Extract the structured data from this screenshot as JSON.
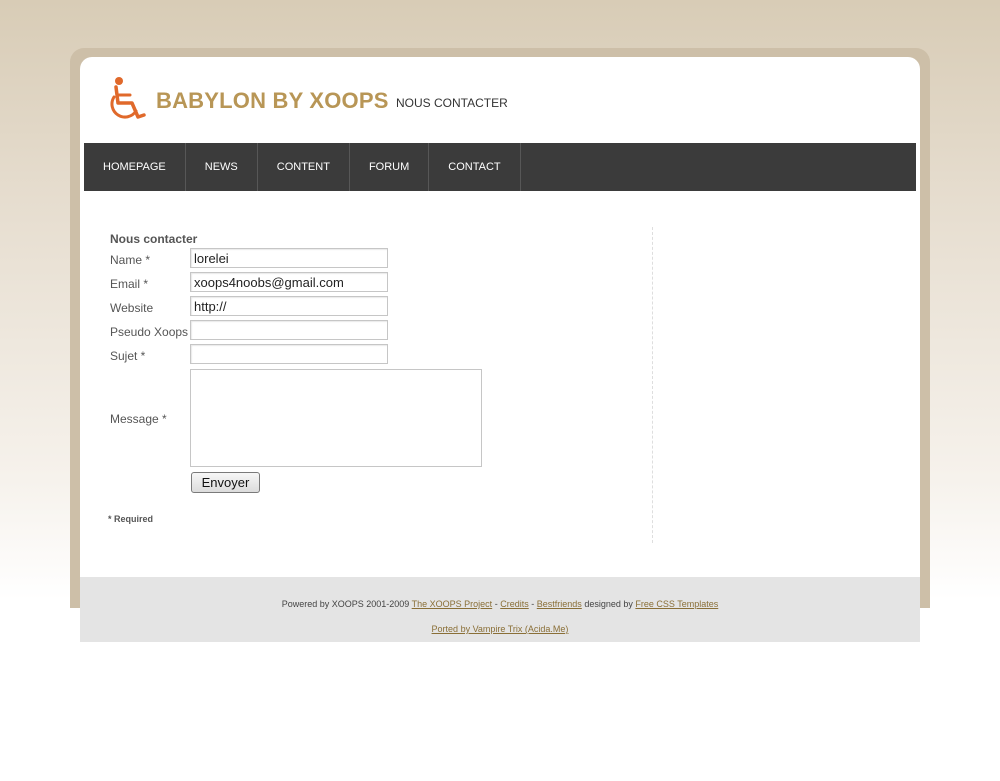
{
  "header": {
    "title": "BABYLON BY XOOPS",
    "subtitle": "NOUS CONTACTER",
    "logo_icon": "wheelchair-icon",
    "accent_color": "#b89656",
    "icon_color": "#e0692b"
  },
  "nav": {
    "items": [
      {
        "label": "HOMEPAGE"
      },
      {
        "label": "NEWS"
      },
      {
        "label": "CONTENT"
      },
      {
        "label": "FORUM"
      },
      {
        "label": "CONTACT"
      }
    ]
  },
  "form": {
    "title": "Nous contacter",
    "name_label": "Name *",
    "name_value": "lorelei",
    "email_label": "Email *",
    "email_value": "xoops4noobs@gmail.com",
    "website_label": "Website",
    "website_value": "http://",
    "pseudo_label": "Pseudo Xoops",
    "pseudo_value": "",
    "subject_label": "Sujet *",
    "subject_value": "",
    "message_label": "Message *",
    "message_value": "",
    "submit_label": "Envoyer",
    "required_note": "* Required"
  },
  "footer": {
    "powered_text": "Powered by XOOPS 2001-2009",
    "xoops_project_link": "The XOOPS Project",
    "sep1": "-",
    "credits_link": "Credits",
    "sep2": "-",
    "bestfriends_link": "Bestfriends",
    "designed_text": "designed by",
    "free_css_link": "Free CSS Templates",
    "ported_link": "Ported by Vampire Trix (Acida.Me)"
  }
}
